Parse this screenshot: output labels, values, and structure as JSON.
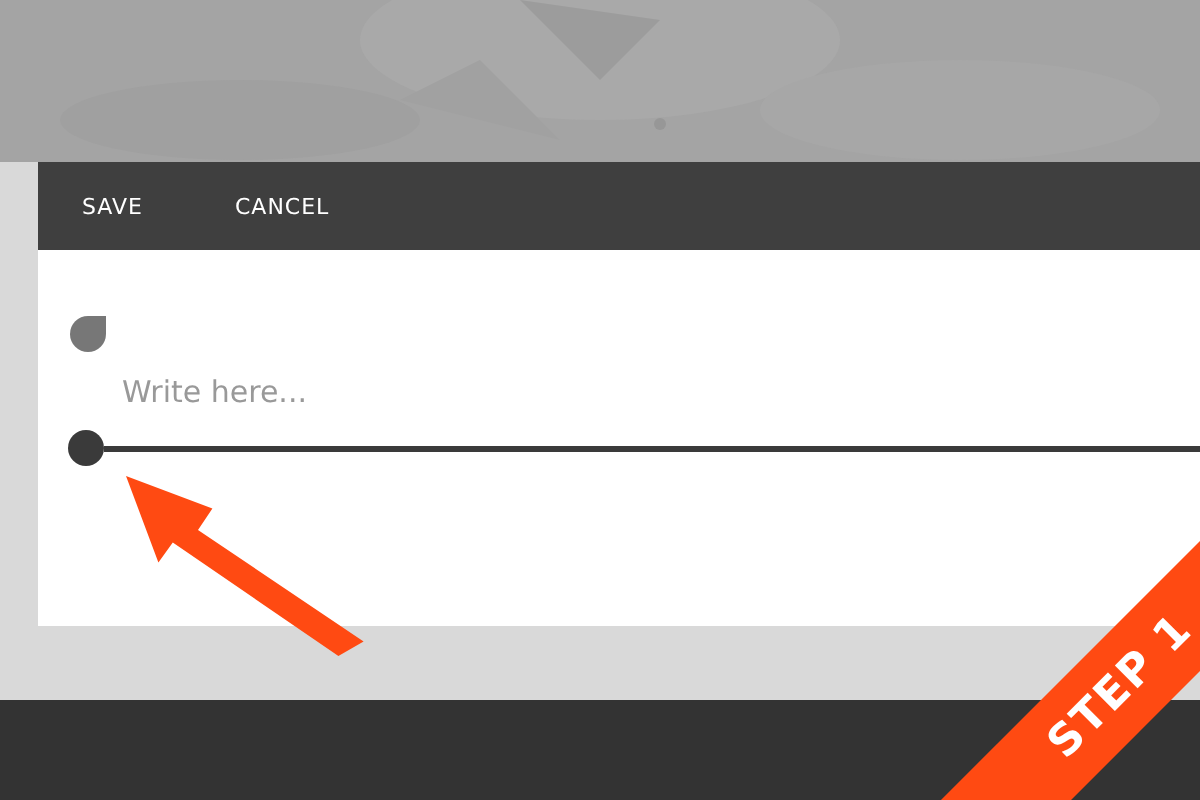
{
  "toolbar": {
    "buttons": [
      {
        "label": "SAVE"
      },
      {
        "label": "CANCEL"
      }
    ]
  },
  "editor": {
    "placeholder": "Write here..."
  },
  "annotation": {
    "label": "STEP 1"
  }
}
